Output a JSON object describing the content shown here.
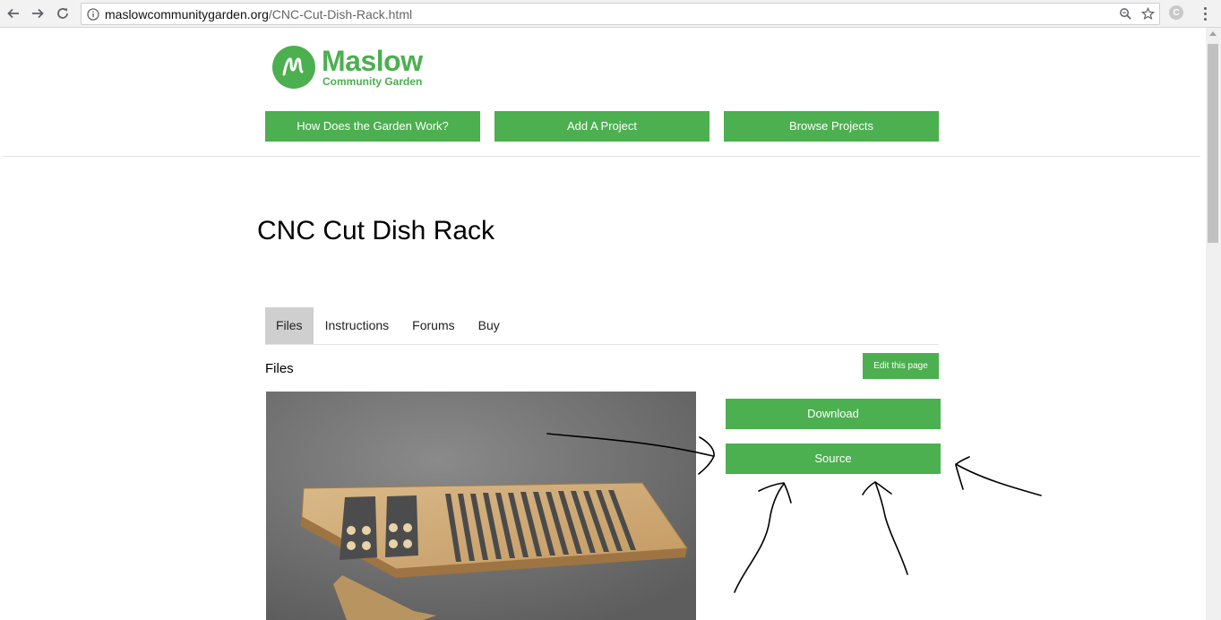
{
  "browser": {
    "url_host": "maslowcommunitygarden.org",
    "url_path": "/CNC-Cut-Dish-Rack.html",
    "extension_label": "C"
  },
  "site": {
    "logo_name": "Maslow",
    "logo_subtitle": "Community Garden",
    "nav": [
      "How Does the Garden Work?",
      "Add A Project",
      "Browse Projects"
    ]
  },
  "project": {
    "title": "CNC Cut Dish Rack",
    "tabs": [
      "Files",
      "Instructions",
      "Forums",
      "Buy"
    ],
    "active_tab": "Files",
    "section_heading": "Files",
    "edit_label": "Edit this page",
    "download_label": "Download",
    "source_label": "Source"
  },
  "colors": {
    "brand_green": "#4caf50"
  }
}
